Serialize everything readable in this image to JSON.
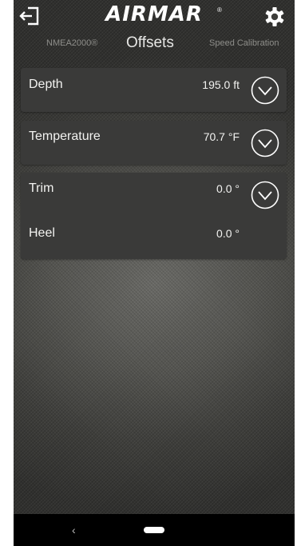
{
  "header": {
    "brand": "AIRMAR",
    "brand_mark": "®",
    "exit_icon": "exit-icon",
    "settings_icon": "gear-icon"
  },
  "tabs": {
    "left": "NMEA2000®",
    "center": "Offsets",
    "right": "Speed Calibration"
  },
  "offsets": {
    "depth": {
      "label": "Depth",
      "value": "195.0 ft"
    },
    "temperature": {
      "label": "Temperature",
      "value": "70.7 °F"
    },
    "trim": {
      "label": "Trim",
      "value": "0.0 °"
    },
    "heel": {
      "label": "Heel",
      "value": "0.0 °"
    }
  },
  "navbar": {
    "back": "‹"
  },
  "colors": {
    "card": "#3a3a39",
    "text": "#f2f2f0",
    "tab_inactive": "#8e8e8a",
    "navbar": "#000000"
  }
}
